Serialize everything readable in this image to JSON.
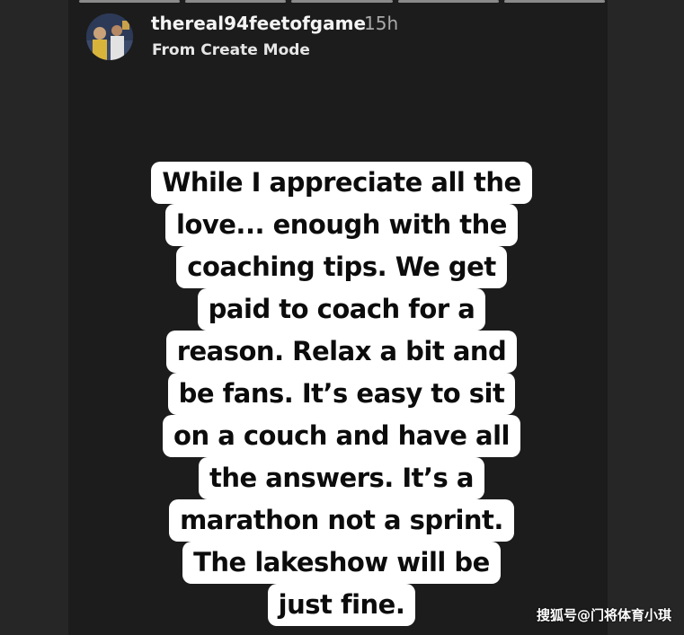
{
  "header": {
    "username": "thereal94feetofgame",
    "time": "15h",
    "subtitle": "From Create Mode"
  },
  "caption_lines": [
    "While I appreciate all the",
    "love... enough with the",
    "coaching tips.  We get",
    "paid to coach for a",
    "reason.  Relax a bit and",
    "be fans.  It’s easy to sit",
    "on a couch and have all",
    "the answers.  It’s a",
    "marathon not a sprint.",
    "The lakeshow will be",
    "just fine."
  ],
  "watermark": "搜狐号@门将体育小琪",
  "colors": {
    "background": "#262626",
    "story_background": "#1c1c1c",
    "caption_background": "#ffffff",
    "caption_text": "#0c0c0c"
  },
  "icons": {
    "avatar": "profile-avatar"
  }
}
